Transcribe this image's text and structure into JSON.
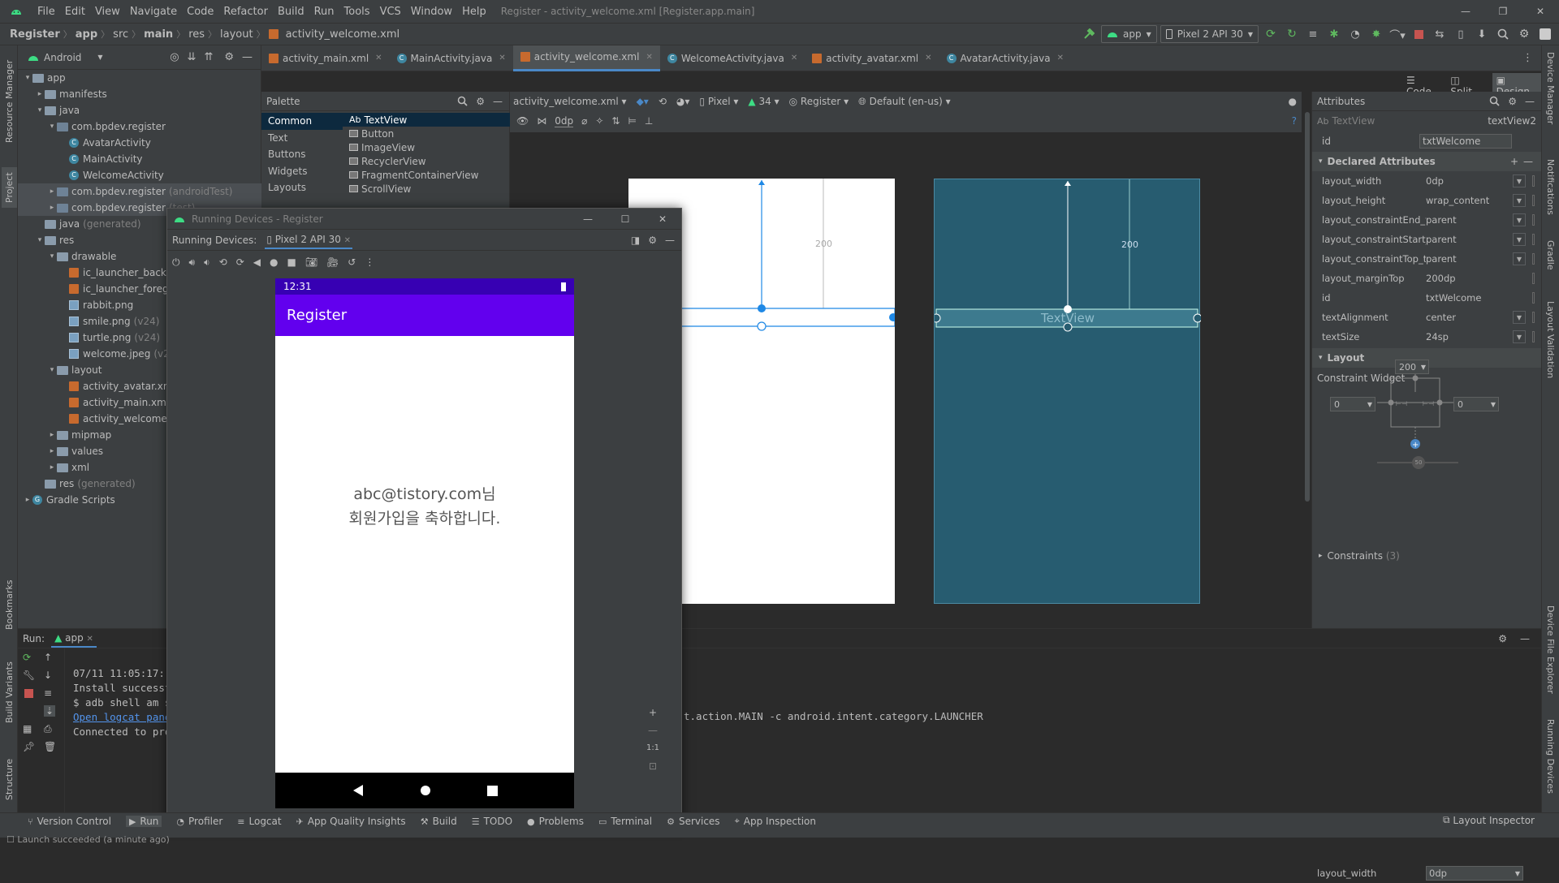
{
  "menu": [
    "File",
    "Edit",
    "View",
    "Navigate",
    "Code",
    "Refactor",
    "Build",
    "Run",
    "Tools",
    "VCS",
    "Window",
    "Help"
  ],
  "window_title": "Register - activity_welcome.xml [Register.app.main]",
  "breadcrumb": {
    "items": [
      "Register",
      "app",
      "src",
      "main",
      "res",
      "layout"
    ],
    "file": "activity_welcome.xml"
  },
  "toolbar": {
    "run_config": "app",
    "device": "Pixel 2 API 30"
  },
  "project": {
    "view": "Android",
    "tree": [
      {
        "label": "app",
        "indent": 0,
        "arrow": "▾",
        "type": "folder",
        "bold": true
      },
      {
        "label": "manifests",
        "indent": 1,
        "arrow": "▸",
        "type": "folder"
      },
      {
        "label": "java",
        "indent": 1,
        "arrow": "▾",
        "type": "folder"
      },
      {
        "label": "com.bpdev.register",
        "indent": 2,
        "arrow": "▾",
        "type": "pkg"
      },
      {
        "label": "AvatarActivity",
        "indent": 3,
        "arrow": "",
        "type": "class"
      },
      {
        "label": "MainActivity",
        "indent": 3,
        "arrow": "",
        "type": "class"
      },
      {
        "label": "WelcomeActivity",
        "indent": 3,
        "arrow": "",
        "type": "class"
      },
      {
        "label": "com.bpdev.register",
        "suffix": "(androidTest)",
        "indent": 2,
        "arrow": "▸",
        "type": "pkg",
        "sel": true
      },
      {
        "label": "com.bpdev.register",
        "suffix": "(test)",
        "indent": 2,
        "arrow": "▸",
        "type": "pkg",
        "sel": true
      },
      {
        "label": "java",
        "suffix": "(generated)",
        "indent": 1,
        "arrow": "",
        "type": "folder"
      },
      {
        "label": "res",
        "indent": 1,
        "arrow": "▾",
        "type": "folder"
      },
      {
        "label": "drawable",
        "indent": 2,
        "arrow": "▾",
        "type": "folder"
      },
      {
        "label": "ic_launcher_background.xml",
        "indent": 3,
        "arrow": "",
        "type": "xml"
      },
      {
        "label": "ic_launcher_foreground.xml",
        "indent": 3,
        "arrow": "",
        "type": "xml"
      },
      {
        "label": "rabbit.png",
        "indent": 3,
        "arrow": "",
        "type": "img"
      },
      {
        "label": "smile.png",
        "suffix": "(v24)",
        "indent": 3,
        "arrow": "",
        "type": "img"
      },
      {
        "label": "turtle.png",
        "suffix": "(v24)",
        "indent": 3,
        "arrow": "",
        "type": "img"
      },
      {
        "label": "welcome.jpeg",
        "suffix": "(v24)",
        "indent": 3,
        "arrow": "",
        "type": "img"
      },
      {
        "label": "layout",
        "indent": 2,
        "arrow": "▾",
        "type": "folder"
      },
      {
        "label": "activity_avatar.xml",
        "indent": 3,
        "arrow": "",
        "type": "xml"
      },
      {
        "label": "activity_main.xml",
        "indent": 3,
        "arrow": "",
        "type": "xml"
      },
      {
        "label": "activity_welcome.xml",
        "indent": 3,
        "arrow": "",
        "type": "xml"
      },
      {
        "label": "mipmap",
        "indent": 2,
        "arrow": "▸",
        "type": "folder"
      },
      {
        "label": "values",
        "indent": 2,
        "arrow": "▸",
        "type": "folder"
      },
      {
        "label": "xml",
        "indent": 2,
        "arrow": "▸",
        "type": "folder"
      },
      {
        "label": "res",
        "suffix": "(generated)",
        "indent": 1,
        "arrow": "",
        "type": "folder"
      },
      {
        "label": "Gradle Scripts",
        "indent": 0,
        "arrow": "▸",
        "type": "gradle"
      }
    ]
  },
  "tabs": [
    {
      "label": "activity_main.xml",
      "icon": "xml",
      "active": false
    },
    {
      "label": "MainActivity.java",
      "icon": "class",
      "active": false
    },
    {
      "label": "activity_welcome.xml",
      "icon": "xml",
      "active": true
    },
    {
      "label": "WelcomeActivity.java",
      "icon": "class",
      "active": false
    },
    {
      "label": "activity_avatar.xml",
      "icon": "xml",
      "active": false
    },
    {
      "label": "AvatarActivity.java",
      "icon": "class",
      "active": false
    }
  ],
  "view_modes": {
    "code": "Code",
    "split": "Split",
    "design": "Design"
  },
  "palette": {
    "title": "Palette",
    "categories": [
      "Common",
      "Text",
      "Buttons",
      "Widgets",
      "Layouts"
    ],
    "items": [
      "TextView",
      "Button",
      "ImageView",
      "RecyclerView",
      "FragmentContainerView",
      "ScrollView"
    ]
  },
  "design_toolbar": {
    "file": "activity_welcome.xml",
    "device": "Pixel",
    "api": "34",
    "theme": "Register",
    "locale": "Default (en-us)",
    "margin": "0dp"
  },
  "canvas": {
    "margin_label": "200",
    "blueprint_text": "TextView"
  },
  "attributes": {
    "title": "Attributes",
    "widget_type": "TextView",
    "widget_id": "textView2",
    "id_label": "id",
    "id_value": "txtWelcome",
    "declared_title": "Declared Attributes",
    "declared": [
      {
        "k": "layout_width",
        "v": "0dp",
        "dd": true
      },
      {
        "k": "layout_height",
        "v": "wrap_content",
        "dd": true
      },
      {
        "k": "layout_constraintEnd_toEndOf",
        "v": "parent",
        "dd": true
      },
      {
        "k": "layout_constraintStart_toStartOf",
        "v": "parent",
        "dd": true
      },
      {
        "k": "layout_constraintTop_toTopOf",
        "v": "parent",
        "dd": true
      },
      {
        "k": "layout_marginTop",
        "v": "200dp",
        "dd": false
      },
      {
        "k": "id",
        "v": "txtWelcome",
        "dd": false
      },
      {
        "k": "textAlignment",
        "v": "center",
        "dd": true
      },
      {
        "k": "textSize",
        "v": "24sp",
        "dd": true
      }
    ],
    "layout_title": "Layout",
    "constraint_widget": "Constraint Widget",
    "top_margin": "200",
    "left_margin": "0",
    "right_margin": "0",
    "bias": "50",
    "constraints": "Constraints",
    "constraints_count": "(3)",
    "bottom_attr": {
      "k": "layout_width",
      "v": "0dp"
    }
  },
  "running_devices": {
    "title": "Running Devices - Register",
    "label": "Running Devices:",
    "tab": "Pixel 2 API 30",
    "phone": {
      "time": "12:31",
      "appbar": "Register",
      "line1": "abc@tistory.com님",
      "line2": "회원가입을 축하합니다.",
      "accent": "#6200ee"
    },
    "zoom": "1:1"
  },
  "run": {
    "label": "Run:",
    "config": "app",
    "console": [
      "07/11 11:05:17: Launching 'app' on Pixel 2 API 30.",
      "Install successfully finished in 1 s 14 ms.",
      "$ adb shell am start -n \"com.bpdev.register/com.bpdev.register.MainActivity\" -a android.intent.action.MAIN -c android.intent.category.LAUNCHER",
      "Open logcat panel for Pixel 2 API 30",
      "Connected to process 4871 on device 'Pixel_2_API_30'."
    ],
    "visible_tail": "t.action.MAIN -c android.intent.category.LAUNCHER"
  },
  "bottom_tabs": [
    "Version Control",
    "Run",
    "Profiler",
    "Logcat",
    "App Quality Insights",
    "Build",
    "TODO",
    "Problems",
    "Terminal",
    "Services",
    "App Inspection"
  ],
  "layout_inspector": "Layout Inspector",
  "status": "Launch succeeded (a minute ago)",
  "left_strip": [
    "Resource Manager",
    "Project",
    "Bookmarks",
    "Build Variants",
    "Structure"
  ],
  "right_strip": [
    "Device Manager",
    "Notifications",
    "Gradle",
    "Layout Validation",
    "Device File Explorer",
    "Running Devices"
  ],
  "colors": {
    "accent": "#4a88c7",
    "blueprint": "#275c70",
    "phone_purple": "#6200ee"
  }
}
